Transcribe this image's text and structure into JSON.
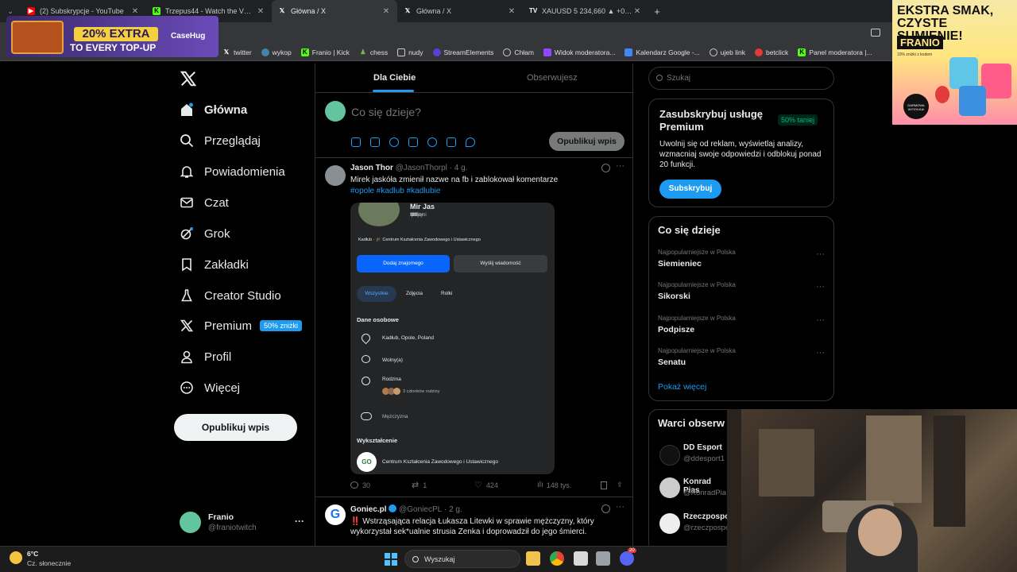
{
  "browser": {
    "tabs": [
      {
        "title": "(2) Subskrypcje - YouTube",
        "icon": "youtube-icon",
        "color": "#ff0000",
        "active": false
      },
      {
        "title": "Trzepus44 - Watch the VOD on",
        "icon": "kick-icon",
        "color": "#53fc18",
        "active": false
      },
      {
        "title": "Główna / X",
        "icon": "x-icon",
        "color": "#ffffff",
        "active": true
      },
      {
        "title": "Główna / X",
        "icon": "x-icon",
        "color": "#ffffff",
        "active": false
      },
      {
        "title": "XAUUSD 5 234,660 ▲ +0,95%",
        "icon": "tradingview-icon",
        "color": "#ffffff",
        "active": false
      }
    ],
    "new_tab": "+",
    "bookmarks": [
      {
        "label": "twitter",
        "icon": "x-icon",
        "color": "#ffffff"
      },
      {
        "label": "wykop",
        "icon": "wykop-icon",
        "color": "#4383af"
      },
      {
        "label": "Franio | Kick",
        "icon": "kick-icon",
        "color": "#53fc18"
      },
      {
        "label": "chess",
        "icon": "chess-icon",
        "color": "#81b64c"
      },
      {
        "label": "nudy",
        "icon": "folder-icon",
        "color": "#cccccc"
      },
      {
        "label": "StreamElements",
        "icon": "streamelements-icon",
        "color": "#5a3fd6"
      },
      {
        "label": "Chłam",
        "icon": "globe-icon",
        "color": "#cccccc"
      },
      {
        "label": "Widok moderatora...",
        "icon": "twitch-icon",
        "color": "#9146ff"
      },
      {
        "label": "Kalendarz Google -...",
        "icon": "calendar-icon",
        "color": "#4285f4"
      },
      {
        "label": "ujeb link",
        "icon": "globe-icon",
        "color": "#cccccc"
      },
      {
        "label": "betclick",
        "icon": "globe-icon",
        "color": "#e53935"
      },
      {
        "label": "Panel moderatora |...",
        "icon": "kick-icon",
        "color": "#53fc18"
      }
    ]
  },
  "ads": {
    "casehug": {
      "badge": "20% EXTRA",
      "line": "TO EVERY TOP-UP",
      "brand": "CaseHug"
    },
    "franio": {
      "headline": "EKSTRA SMAK, CZYSTE SUMIENIE!",
      "brand": "FRANIO",
      "small": "10% zniżki z kodem",
      "seal": "DARMOWA WYSYŁKA!"
    }
  },
  "nav": {
    "items": [
      {
        "label": "Główna",
        "icon": "home-icon",
        "bold": true
      },
      {
        "label": "Przeglądaj",
        "icon": "search-icon",
        "bold": false
      },
      {
        "label": "Powiadomienia",
        "icon": "bell-icon",
        "bold": false
      },
      {
        "label": "Czat",
        "icon": "mail-icon",
        "bold": false
      },
      {
        "label": "Grok",
        "icon": "grok-icon",
        "bold": false
      },
      {
        "label": "Zakładki",
        "icon": "bookmark-icon",
        "bold": false
      },
      {
        "label": "Creator Studio",
        "icon": "flask-icon",
        "bold": false
      },
      {
        "label": "Premium",
        "icon": "x-icon",
        "bold": false
      },
      {
        "label": "Profil",
        "icon": "person-icon",
        "bold": false
      },
      {
        "label": "Więcej",
        "icon": "more-circle-icon",
        "bold": false
      }
    ],
    "premium_badge": "50% zniżki",
    "post_button": "Opublikuj wpis",
    "account": {
      "name": "Franio",
      "handle": "@franiotwitch",
      "more": "···"
    }
  },
  "feed": {
    "tab_for_you": "Dla Ciebie",
    "tab_following": "Obserwujesz",
    "compose_placeholder": "Co się dzieje?",
    "compose_button": "Opublikuj wpis",
    "accent": "#1d9bf0",
    "tweet1": {
      "name": "Jason Thor",
      "handle": "@JasonThorpl",
      "time": "· 4 g.",
      "text": "Mirek jaskóła zmienił nazwe na fb i zablokował komentarze",
      "hashtags": "#opole #kadlub #kadlubie",
      "replies": "30",
      "reposts": "1",
      "likes": "424",
      "views": "148 tys."
    },
    "tweet1_image": {
      "profile_name": "Mir Jas",
      "friends_count": "987",
      "friends_label": "znajomi",
      "posts_count": "26",
      "posts_label": "posty",
      "location_line": "Kadłub · 🎓 Centrum Kształcenia Zawodowego i Ustawicznego",
      "add_friend": "Dodaj znajomego",
      "send_message": "Wyślij wiadomość",
      "filter_all": "Wszystkie",
      "filter_photos": "Zdjęcia",
      "filter_reels": "Rolki",
      "section_personal": "Dane osobowe",
      "city": "Kadłub, Opole, Poland",
      "status": "Wolny(a)",
      "family_label": "Rodzina",
      "family_members": "3 członków rodziny",
      "gender": "Mężczyzna",
      "section_education": "Wykształcenie",
      "school": "Centrum Kształcenia Zawodowego i Ustawicznego",
      "school_logo": "GO"
    },
    "tweet2": {
      "name": "Goniec.pl",
      "handle": "@GoniecPL",
      "time": "· 2 g.",
      "text": "‼️ Wstrząsająca relacja Łukasza Litewki w sprawie mężczyzny, który wykorzystał sek*ualnie strusia Zenka i doprowadził do jego śmierci."
    }
  },
  "sidebar": {
    "search_placeholder": "Szukaj",
    "premium": {
      "title": "Zasubskrybuj usługę Premium",
      "badge": "50% taniej",
      "desc": "Uwolnij się od reklam, wyświetlaj analizy, wzmacniaj swoje odpowiedzi i odblokuj ponad 20 funkcji.",
      "button": "Subskrybuj"
    },
    "trends": {
      "title": "Co się dzieje",
      "items": [
        {
          "category": "Najpopularniejsze w Polska",
          "name": "Siemieniec"
        },
        {
          "category": "Najpopularniejsze w Polska",
          "name": "Sikorski"
        },
        {
          "category": "Najpopularniejsze w Polska",
          "name": "Podpisze"
        },
        {
          "category": "Najpopularniejsze w Polska",
          "name": "Senatu"
        }
      ],
      "more": "Pokaż więcej"
    },
    "who_to_follow": {
      "title": "Warci obserw",
      "items": [
        {
          "name": "DD Esport",
          "handle": "@ddesport1"
        },
        {
          "name": "Konrad Pias",
          "handle": "@KonradPia"
        },
        {
          "name": "Rzeczpospo",
          "handle": "@rzeczpospo"
        }
      ]
    }
  },
  "taskbar": {
    "temp": "6°C",
    "weather": "Cz. słonecznie",
    "search": "Wyszukaj",
    "discord_badge": "20"
  }
}
